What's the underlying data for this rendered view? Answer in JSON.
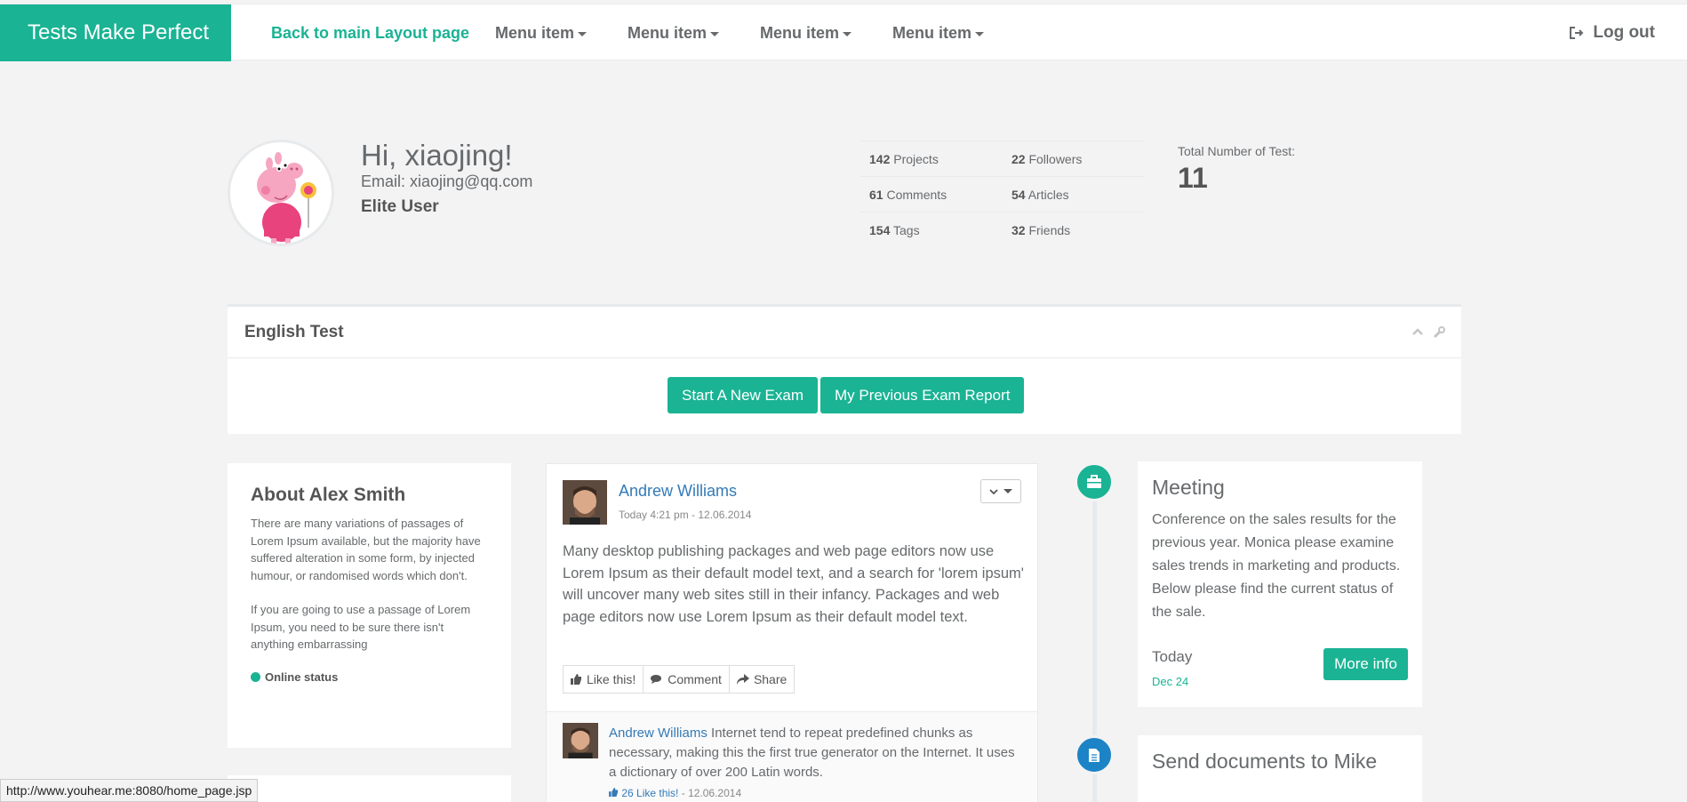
{
  "navbar": {
    "brand": "Tests Make Perfect",
    "back_link": "Back to main Layout page",
    "menus": [
      "Menu item",
      "Menu item",
      "Menu item",
      "Menu item"
    ],
    "logout": "Log out"
  },
  "profile": {
    "greeting": "Hi, xiaojing!",
    "email": "Email: xiaojing@qq.com",
    "level": "Elite User",
    "stats": [
      {
        "value": "142",
        "label": "Projects"
      },
      {
        "value": "22",
        "label": "Followers"
      },
      {
        "value": "61",
        "label": "Comments"
      },
      {
        "value": "54",
        "label": "Articles"
      },
      {
        "value": "154",
        "label": "Tags"
      },
      {
        "value": "32",
        "label": "Friends"
      }
    ],
    "total_label": "Total Number of Test:",
    "total_value": "11"
  },
  "english_test": {
    "title": "English Test",
    "start_button": "Start A New Exam",
    "report_button": "My Previous Exam Report"
  },
  "about": {
    "title": "About Alex Smith",
    "para1": "There are many variations of passages of Lorem Ipsum available, but the majority have suffered alteration in some form, by injected humour, or randomised words which don't.",
    "para2": "If you are going to use a passage of Lorem Ipsum, you need to be sure there isn't anything embarrassing",
    "status": "Online status"
  },
  "feed": {
    "author": "Andrew Williams",
    "time": "Today 4:21 pm - 12.06.2014",
    "text": "Many desktop publishing packages and web page editors now use Lorem Ipsum as their default model text, and a search for 'lorem ipsum' will uncover many web sites still in their infancy. Packages and web page editors now use Lorem Ipsum as their default model text.",
    "actions": {
      "like": "Like this!",
      "comment": "Comment",
      "share": "Share"
    },
    "comment": {
      "author": "Andrew Williams",
      "text": " Internet tend to repeat predefined chunks as necessary, making this the first true generator on the Internet. It uses a dictionary of over 200 Latin words.",
      "likes": "26 Like this!",
      "date": " - 12.06.2014"
    }
  },
  "timeline": [
    {
      "icon": "briefcase-icon",
      "title": "Meeting",
      "text": "Conference on the sales results for the previous year. Monica please examine sales trends in marketing and products. Below please find the current status of the sale.",
      "today": "Today",
      "date": "Dec 24",
      "button": "More info"
    },
    {
      "icon": "file-icon",
      "title": "Send documents to Mike"
    }
  ],
  "statusbar": {
    "url": "http://www.youhear.me:8080/home_page.jsp"
  },
  "colors": {
    "accent": "#1ab394",
    "link": "#337ab7",
    "timeline_blue": "#1c84c6"
  }
}
